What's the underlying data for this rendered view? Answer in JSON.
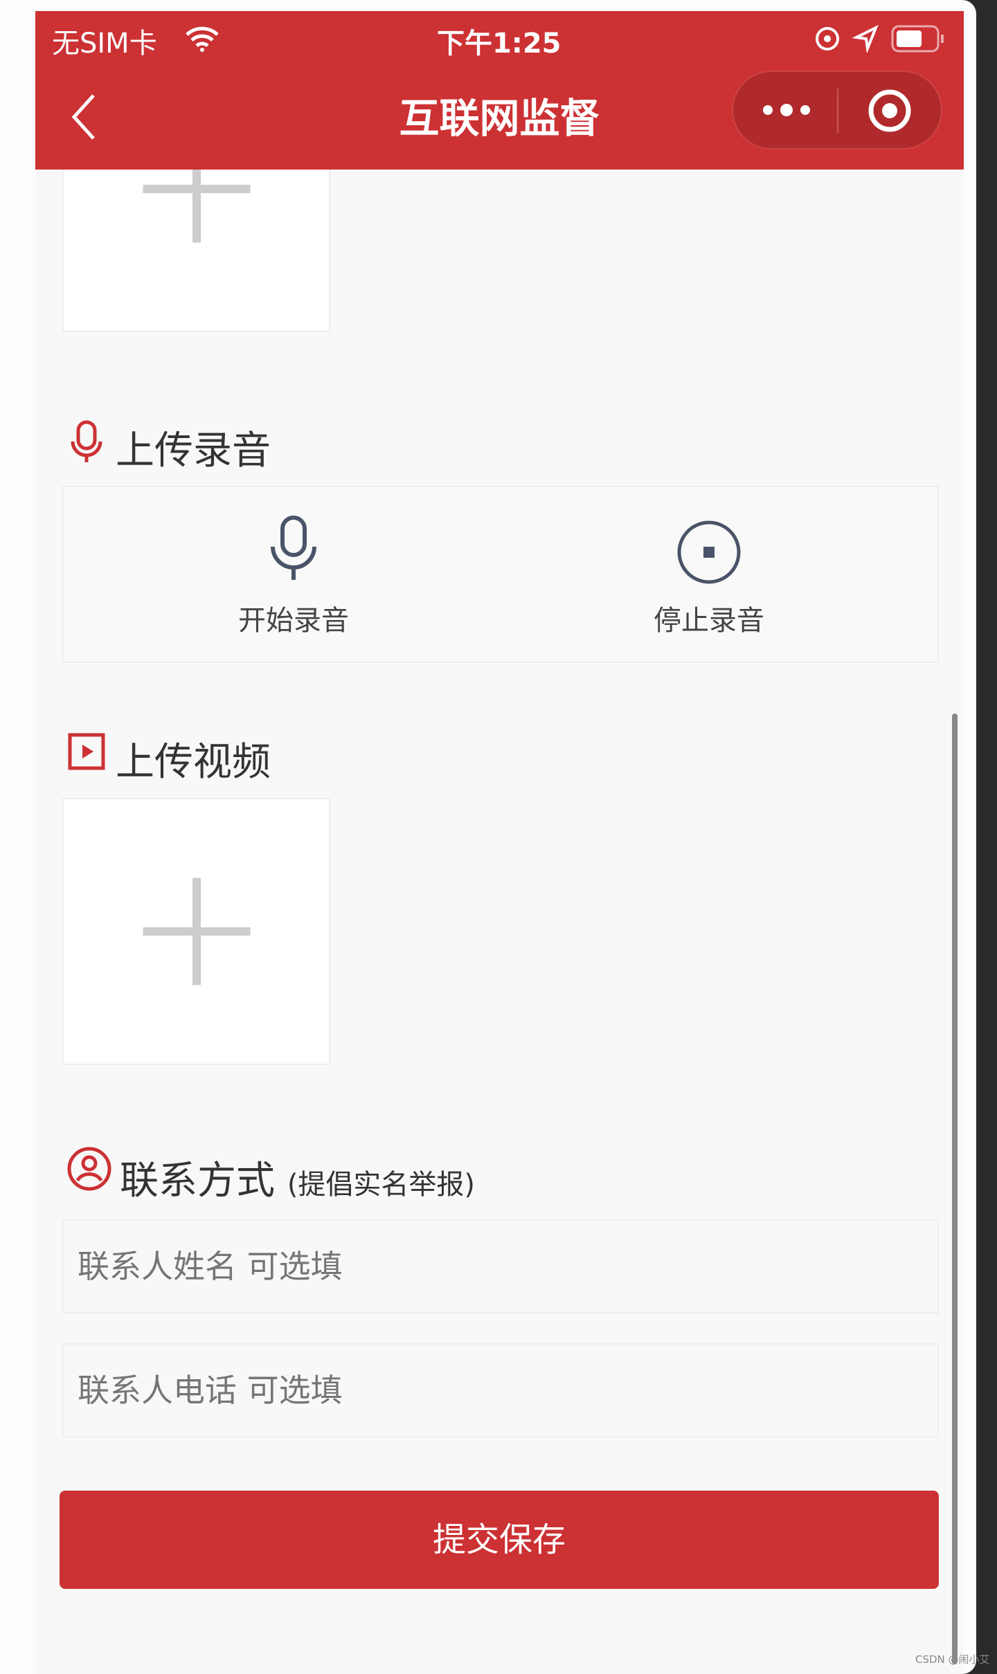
{
  "status_bar": {
    "carrier": "无SIM卡",
    "time": "下午1:25"
  },
  "nav": {
    "title": "互联网监督",
    "more_icon": "more-dots-icon",
    "close_icon": "target-circle-icon"
  },
  "audio": {
    "title": "上传录音",
    "start": "开始录音",
    "stop": "停止录音"
  },
  "video": {
    "title": "上传视频"
  },
  "contact": {
    "title": "联系方式",
    "note": "(提倡实名举报)",
    "name_placeholder": "联系人姓名 可选填",
    "phone_placeholder": "联系人电话 可选填"
  },
  "submit_label": "提交保存",
  "watermark": "CSDN @闹小艾",
  "colors": {
    "brand": "#cc3134"
  }
}
